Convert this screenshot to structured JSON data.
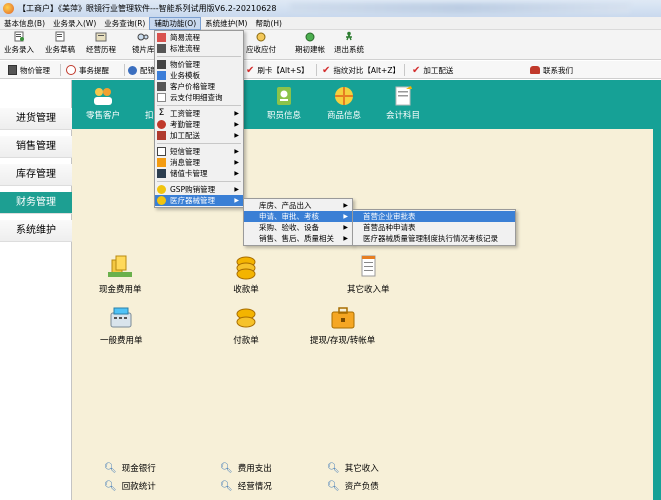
{
  "window": {
    "title": "【工商户】《美萍》眼镜行业管理软件---智能系列试用版V6.2-20210628"
  },
  "menubar": {
    "items": [
      "基本信息(B)",
      "业务录入(W)",
      "业务查询(R)",
      "辅助功能(O)",
      "系统维护(M)",
      "帮助(H)"
    ]
  },
  "toolbar": {
    "items": [
      "业务录入",
      "业务草稿",
      "经营历程",
      "镜片库",
      "应收应付",
      "期初建帐",
      "退出系统"
    ]
  },
  "quickbar": {
    "items": [
      "物价管理",
      "事务提醒",
      "配镜",
      "刷卡【Alt+S】",
      "指纹对比【Alt+Z】",
      "加工配送",
      "联系我们"
    ]
  },
  "sidebar": {
    "items": [
      "进货管理",
      "销售管理",
      "库存管理",
      "财务管理",
      "系统维护"
    ],
    "active_index": 3
  },
  "tiles": {
    "items": [
      "零售客户",
      "扣",
      "职员信息",
      "商品信息",
      "会计科目"
    ]
  },
  "dashboard": {
    "items": [
      "现金费用单",
      "收款单",
      "其它收入单",
      "一般费用单",
      "付款单",
      "提现/存现/转帐单"
    ]
  },
  "bottom_links": {
    "items": [
      "现金银行",
      "费用支出",
      "其它收入",
      "回款统计",
      "经营情况",
      "资产负债"
    ]
  },
  "aux_menu": {
    "items": [
      "简易流程",
      "标准流程",
      "物价管理",
      "业务模板",
      "客户价格管理",
      "云支付明细查询",
      "工资管理",
      "考勤管理",
      "加工配送",
      "短信管理",
      "消息管理",
      "储值卡管理",
      "GSP购销管理",
      "医疗器械管理"
    ]
  },
  "sub_menu": {
    "items": [
      "库房、产品出入",
      "申请、审批、考核",
      "采购、验收、设备",
      "销售、售后、质量相关"
    ]
  },
  "sub_sub_menu": {
    "items": [
      "首营企业审批表",
      "首营品种申请表",
      "医疗器械质量管理制度执行情况考核记录"
    ]
  }
}
